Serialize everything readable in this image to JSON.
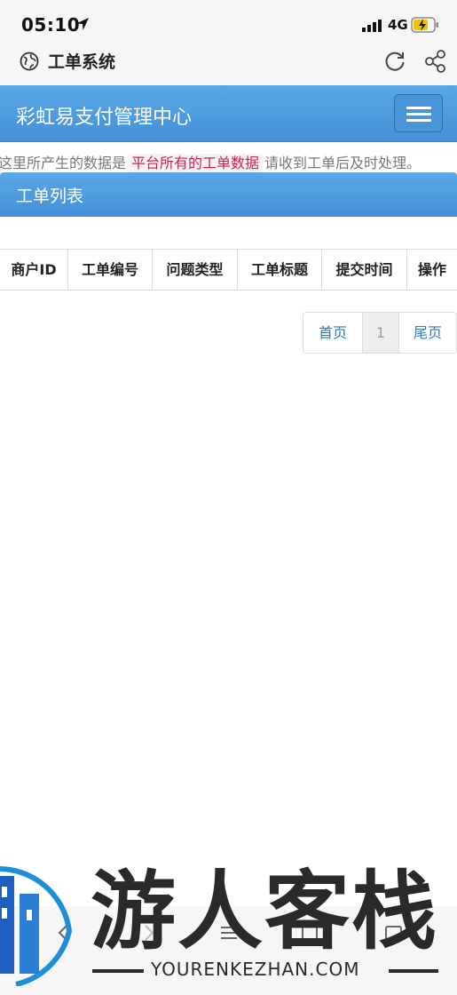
{
  "status_bar": {
    "time": "05:10",
    "network": "4G"
  },
  "browser": {
    "title": "工单系统"
  },
  "navbar": {
    "brand": "彩虹易支付管理中心"
  },
  "notice": {
    "prefix": "这里所产生的数据是",
    "highlight": "平台所有的工单数据",
    "suffix": "请收到工单后及时处理。"
  },
  "panel": {
    "title": "工单列表"
  },
  "table": {
    "headers": [
      "商户ID",
      "工单编号",
      "问题类型",
      "工单标题",
      "提交时间",
      "操作"
    ]
  },
  "pagination": {
    "first": "首页",
    "current": "1",
    "last": "尾页"
  },
  "watermark": {
    "text": "游人客栈",
    "url": "YOURENKEZHAN.COM"
  },
  "colors": {
    "navbar": "#4a9be0",
    "link": "#337ab7",
    "highlight": "#c7254e"
  }
}
